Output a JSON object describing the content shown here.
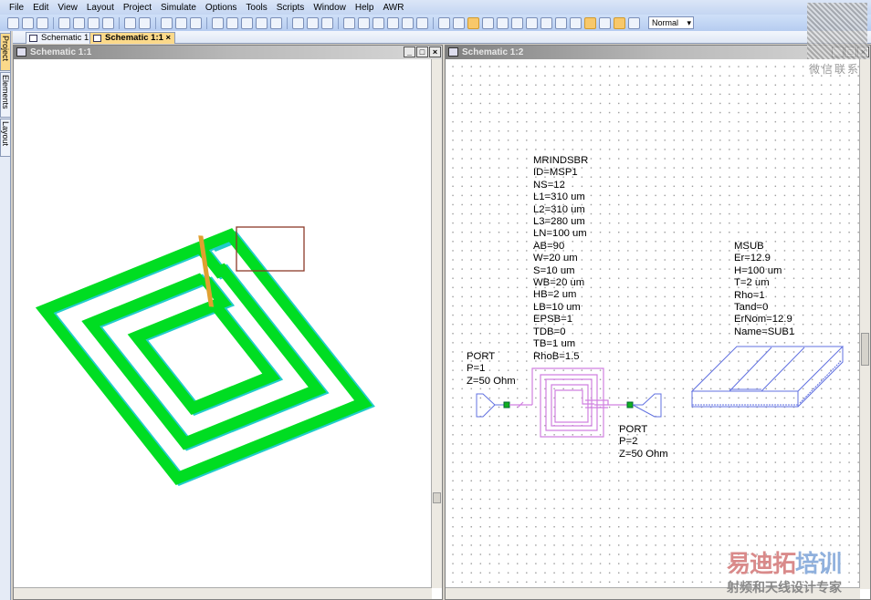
{
  "menu": [
    "File",
    "Edit",
    "View",
    "Layout",
    "Project",
    "Simulate",
    "Options",
    "Tools",
    "Scripts",
    "Window",
    "Help",
    "AWR"
  ],
  "toolbar": {
    "zoom_mode": "Normal"
  },
  "tabs": [
    {
      "label": "Schematic 1:2",
      "active": false
    },
    {
      "label": "Schematic 1:1",
      "active": true,
      "close": "×"
    }
  ],
  "side_tabs": [
    "Project",
    "Elements",
    "Layout"
  ],
  "left_window": {
    "title": "Schematic 1:1",
    "buttons": [
      "_",
      "□",
      "×"
    ],
    "colors": {
      "metal": "#00dd22",
      "shadow": "#22cccc",
      "highlight": "#8b3a2a"
    }
  },
  "right_window": {
    "title": "Schematic 1:2",
    "buttons": [
      "_",
      "□",
      "×"
    ],
    "inductor": {
      "lines": [
        "MRINDSBR",
        "ID=MSP1",
        "NS=12",
        "L1=310 um",
        "L2=310 um",
        "L3=280 um",
        "LN=100 um",
        "AB=90",
        "W=20 um",
        "S=10 um",
        "WB=20 um",
        "HB=2 um",
        "LB=10 um",
        "EPSB=1",
        "TDB=0",
        "TB=1 um",
        "RhoB=1.5"
      ]
    },
    "substrate": {
      "lines": [
        "MSUB",
        "Er=12.9",
        "H=100 um",
        "T=2 um",
        "Rho=1",
        "Tand=0",
        "ErNom=12.9",
        "Name=SUB1"
      ]
    },
    "port1": {
      "lines": [
        "PORT",
        "P=1",
        "Z=50 Ohm"
      ]
    },
    "port2": {
      "lines": [
        "PORT",
        "P=2",
        "Z=50 Ohm"
      ]
    }
  },
  "watermark": {
    "brand": "易迪拓培训",
    "slogan": "射频和天线设计专家",
    "qr_caption": "微信联系"
  }
}
